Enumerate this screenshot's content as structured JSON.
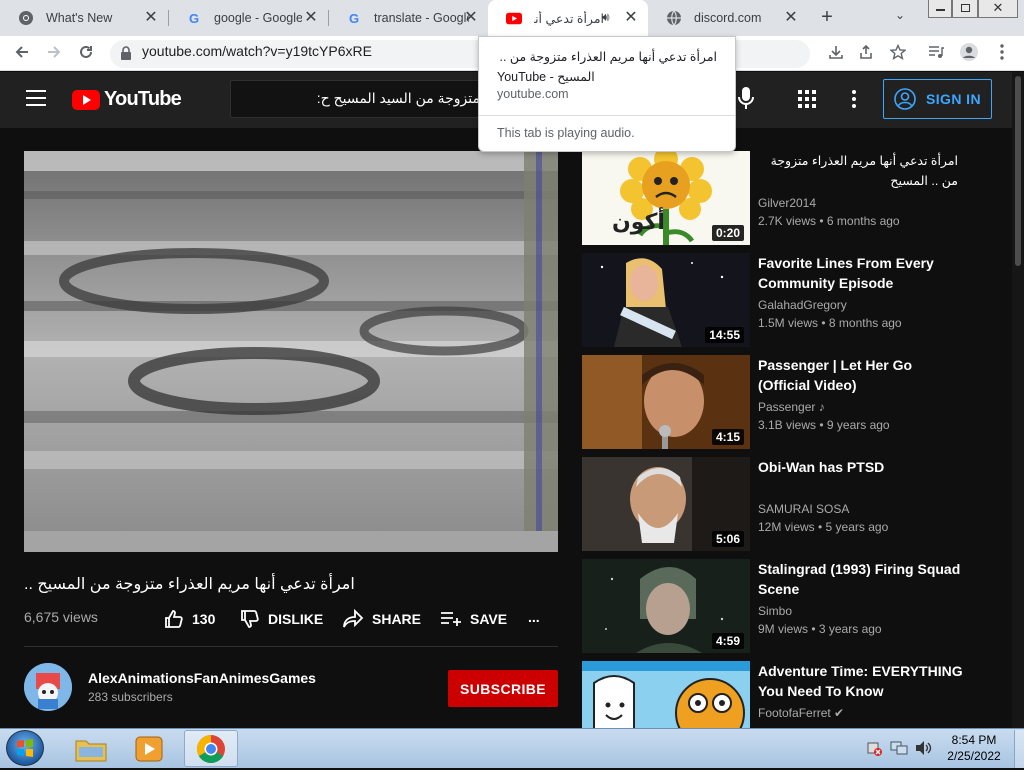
{
  "browser": {
    "tabs": [
      {
        "title": "What's New",
        "icon": "chrome-icon"
      },
      {
        "title": "google - Google Search",
        "icon": "google-icon"
      },
      {
        "title": "translate - Google Search",
        "icon": "google-icon"
      },
      {
        "title": "امرأة تدعي أنها .. ",
        "icon": "youtube-icon",
        "active": true
      },
      {
        "title": "discord.com",
        "icon": "globe-icon"
      }
    ],
    "url": "youtube.com/watch?v=y19tcYP6xRE",
    "new_tab_label": "+",
    "hover_card": {
      "title_line1": "امرأة تدعي أنها مريم العذراء متزوجة من ..",
      "title_line2": "YouTube - المسيح",
      "domain": "youtube.com",
      "audio": "This tab is playing audio."
    }
  },
  "youtube": {
    "logo_text": "YouTube",
    "search_value": "متزوجة من السيد المسيح ح:",
    "signin_label": "SIGN IN",
    "video": {
      "title": "امرأة تدعي أنها مريم العذراء متزوجة من المسيح ..",
      "views": "6,675 views",
      "likes": "130",
      "dislike_label": "DISLIKE",
      "share_label": "SHARE",
      "save_label": "SAVE",
      "more": "..."
    },
    "channel": {
      "name": "AlexAnimationsFanAnimesGames",
      "subscribers": "283 subscribers",
      "subscribe_label": "SUBSCRIBE"
    },
    "recommendations": [
      {
        "title": "امرأة تدعي أنها مريم العذراء متزوجة من .. المسيح",
        "channel": "Gilver2014",
        "meta": "2.7K views • 6 months ago",
        "duration": "0:20",
        "thumb_text": "أكون"
      },
      {
        "title": "Favorite Lines From Every Community Episode",
        "channel": "GalahadGregory",
        "meta": "1.5M views • 8 months ago",
        "duration": "14:55"
      },
      {
        "title": "Passenger | Let Her Go (Official Video)",
        "channel": "Passenger ♪",
        "meta": "3.1B views • 9 years ago",
        "duration": "4:15"
      },
      {
        "title": "Obi-Wan has PTSD",
        "channel": "SAMURAI SOSA",
        "meta": "12M views • 5 years ago",
        "duration": "5:06"
      },
      {
        "title": "Stalingrad (1993) Firing Squad Scene",
        "channel": "Simbo",
        "meta": "9M views • 3 years ago",
        "duration": "4:59"
      },
      {
        "title": "Adventure Time: EVERYTHING You Need To Know (COMPLET...",
        "channel": "FootofaFerret ✔",
        "meta": "",
        "duration": ""
      }
    ]
  },
  "taskbar": {
    "time": "8:54 PM",
    "date": "2/25/2022"
  }
}
